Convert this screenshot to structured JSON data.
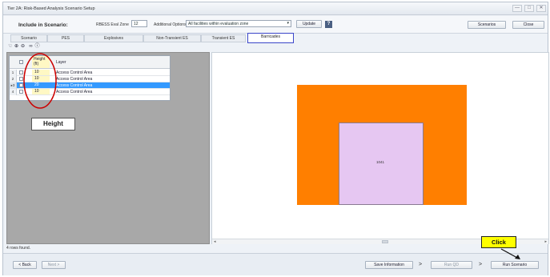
{
  "window": {
    "title": "Tier 2A: Risk-Based Analysis Scenario Setup",
    "min": "—",
    "max": "□"
  },
  "toolbar": {
    "include_label": "Include in Scenario:",
    "rbess_label": "RBESS Eval Zone",
    "rbess_value": "12",
    "additional_label": "Additional Options",
    "additional_value": "All facilities within evaluation zone",
    "dropdown_arrow": "▾",
    "update_label": "Update",
    "help_label": "?",
    "scenarios_label": "Scenarios",
    "close_label": "Close"
  },
  "tabs": [
    {
      "label": "Scenario"
    },
    {
      "label": "PES"
    },
    {
      "label": "Explosives"
    },
    {
      "label": "Non-Transient ES"
    },
    {
      "label": "Transient ES"
    },
    {
      "label": "Barricades"
    }
  ],
  "map_tools": {
    "icons": [
      "pan-icon",
      "zoom-in-icon",
      "zoom-out-icon",
      "binoculars-icon",
      "info-icon"
    ]
  },
  "grid": {
    "headers": {
      "height": "Height (ft)",
      "layer": "Layer"
    },
    "rows": [
      {
        "num": "1",
        "height": "10",
        "layer": "Access Control Area"
      },
      {
        "num": "2",
        "height": "10",
        "layer": "Access Control Area"
      },
      {
        "num": "3",
        "height": "20",
        "layer": "Access Control Area",
        "marker": "▸"
      },
      {
        "num": "4",
        "height": "10",
        "layer": "Access Control Area"
      }
    ]
  },
  "annotation": {
    "height_label": "Height",
    "click_label": "Click",
    "highlight_color": "#cc0000",
    "callout_color": "#ffff00"
  },
  "map": {
    "building_label": "1041",
    "outer_color": "#ff7f00",
    "inner_color": "#e6c7f2"
  },
  "status": {
    "rows_found": "4 rows found."
  },
  "footer": {
    "back_label": "< Back",
    "next_label": "Next >",
    "save_info_label": "Save Information",
    "run_qd_label": "Run QD",
    "run_scenario_label": "Run Scenario",
    "arrow_glyph": ">"
  }
}
